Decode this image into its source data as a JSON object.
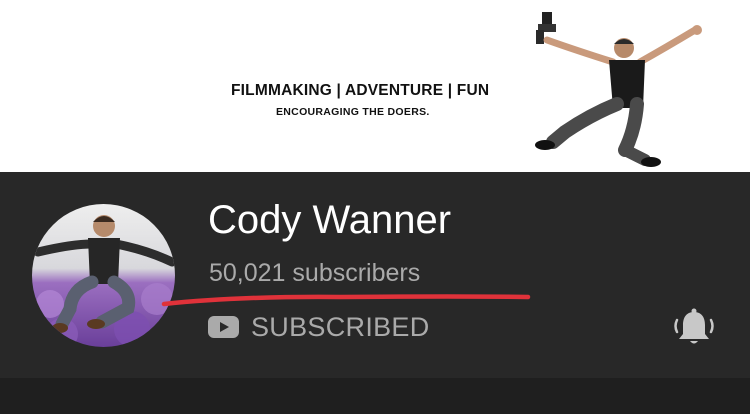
{
  "banner": {
    "tagline": "FILMMAKING | ADVENTURE | FUN",
    "subtitle": "ENCOURAGING THE DOERS."
  },
  "channel": {
    "name": "Cody Wanner",
    "subscribers": "50,021 subscribers",
    "subscribe_button_label": "SUBSCRIBED",
    "subscribe_icon": "youtube-play-icon",
    "notification_icon": "bell-icon"
  },
  "annotation": {
    "type": "hand-drawn underline",
    "color": "#e0323a"
  },
  "colors": {
    "background": "#282828",
    "banner_background": "#ffffff",
    "name_text": "#ffffff",
    "secondary_text": "#aaaaaa"
  }
}
